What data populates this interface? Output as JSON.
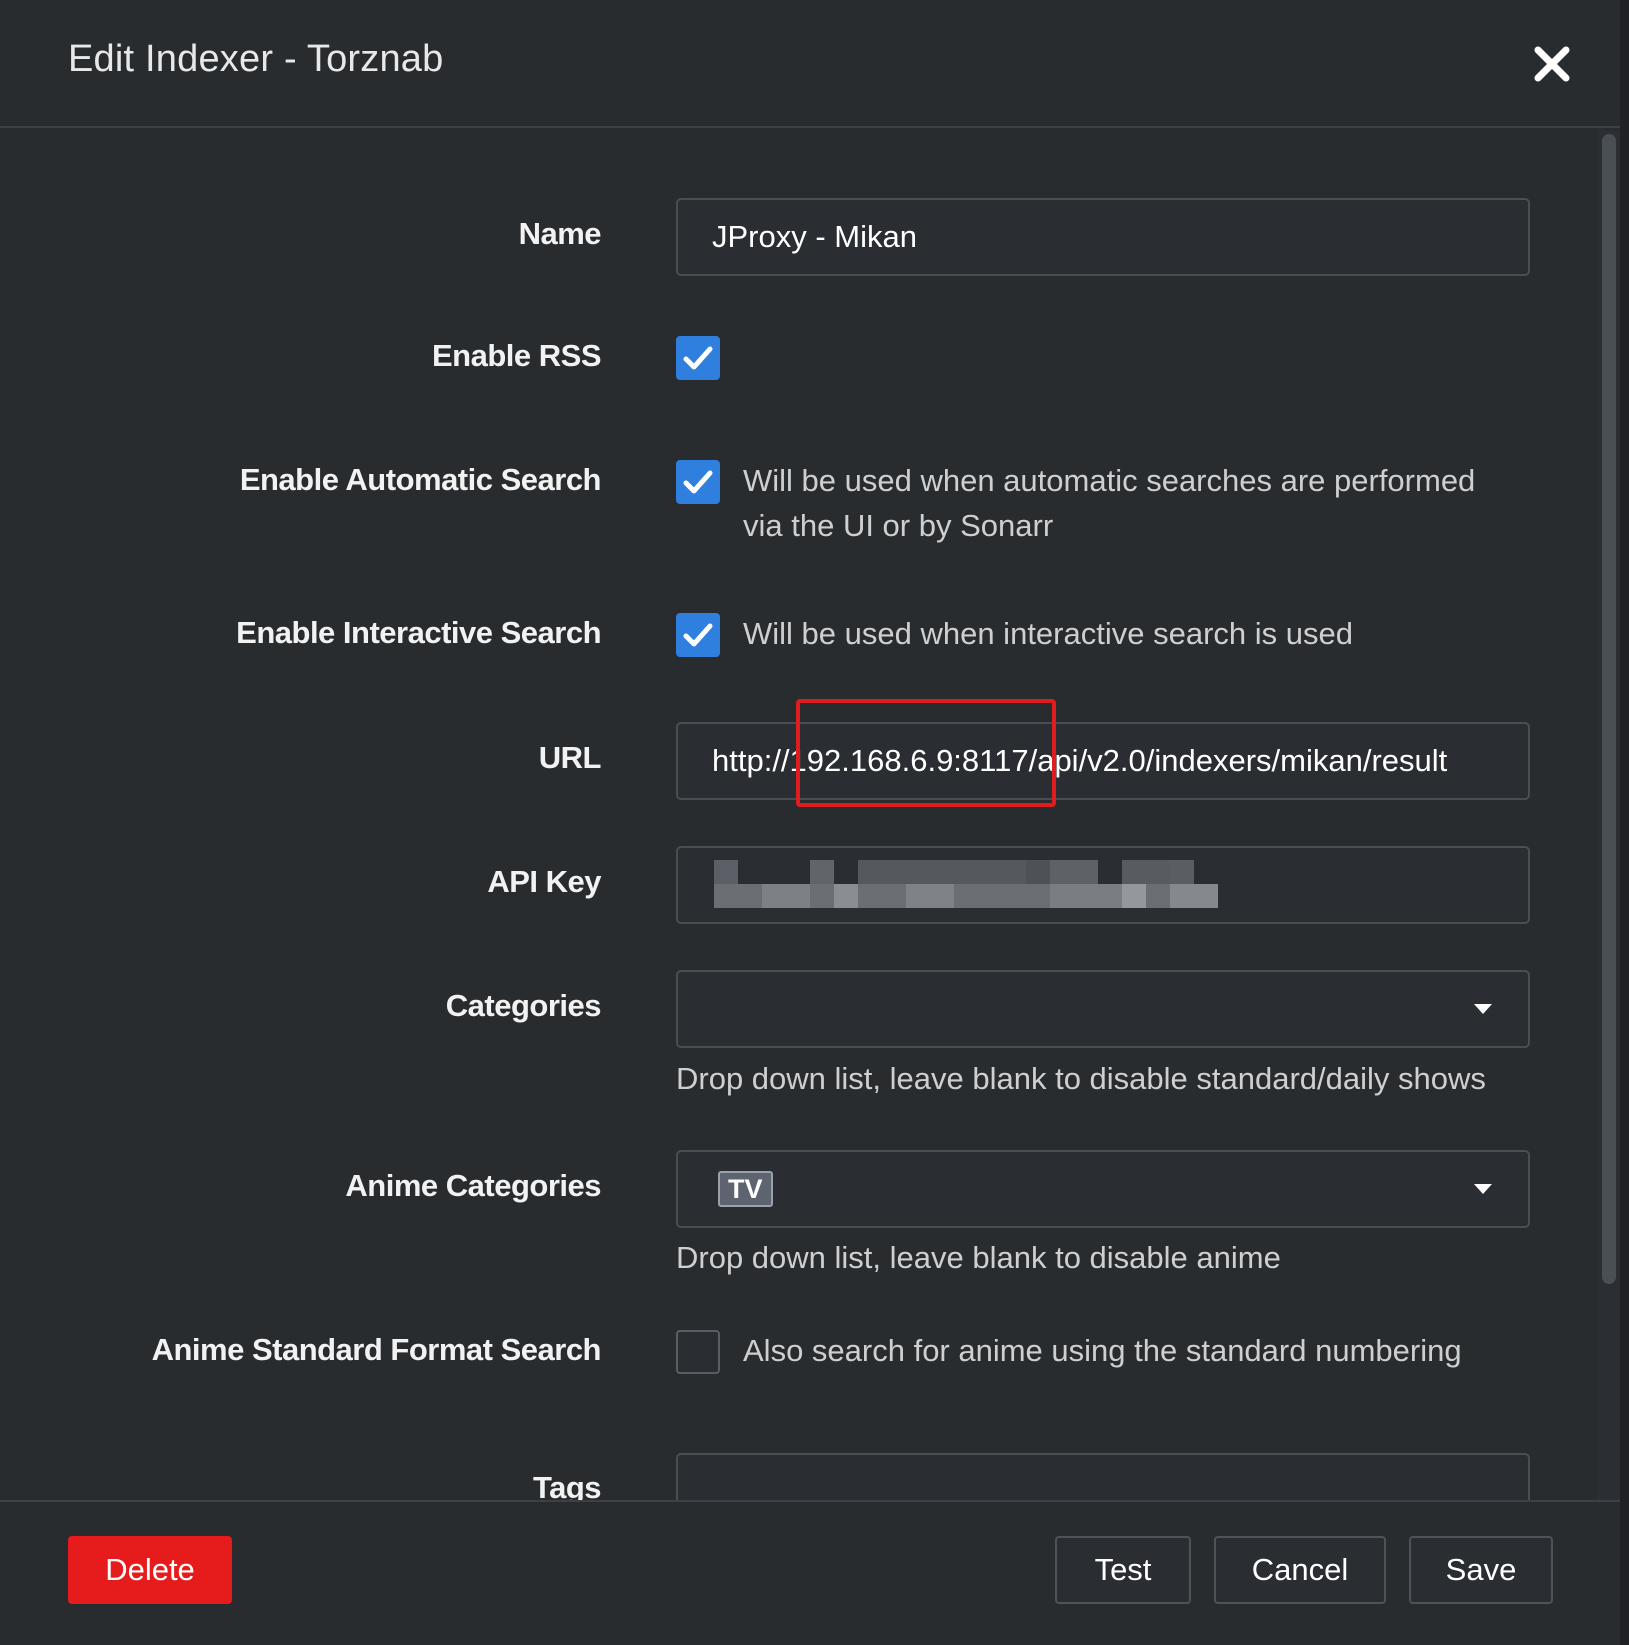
{
  "modal": {
    "title": "Edit Indexer - Torznab"
  },
  "form": {
    "name": {
      "label": "Name",
      "value": "JProxy - Mikan"
    },
    "enable_rss": {
      "label": "Enable RSS",
      "checked": true
    },
    "enable_automatic_search": {
      "label": "Enable Automatic Search",
      "checked": true,
      "help_line1": "Will be used when automatic searches are performed",
      "help_line2": "via the UI or by Sonarr"
    },
    "enable_interactive_search": {
      "label": "Enable Interactive Search",
      "checked": true,
      "help": "Will be used when interactive search is used"
    },
    "url": {
      "label": "URL",
      "value": "http://192.168.6.9:8117/api/v2.0/indexers/mikan/result"
    },
    "api_key": {
      "label": "API Key"
    },
    "categories": {
      "label": "Categories",
      "help": "Drop down list, leave blank to disable standard/daily shows"
    },
    "anime_categories": {
      "label": "Anime Categories",
      "selected_tag": "TV",
      "help": "Drop down list, leave blank to disable anime"
    },
    "anime_standard_format_search": {
      "label": "Anime Standard Format Search",
      "checked": false,
      "help": "Also search for anime using the standard numbering"
    },
    "tags": {
      "label": "Tags"
    }
  },
  "footer": {
    "delete_label": "Delete",
    "test_label": "Test",
    "cancel_label": "Cancel",
    "save_label": "Save"
  },
  "colors": {
    "checkbox_checked": "#2f7fdf",
    "danger": "#e61c1c",
    "highlight_box": "#e01c1c"
  },
  "icons": {
    "close": "close-icon",
    "check": "checkmark-icon",
    "dropdown": "caret-down-icon"
  }
}
